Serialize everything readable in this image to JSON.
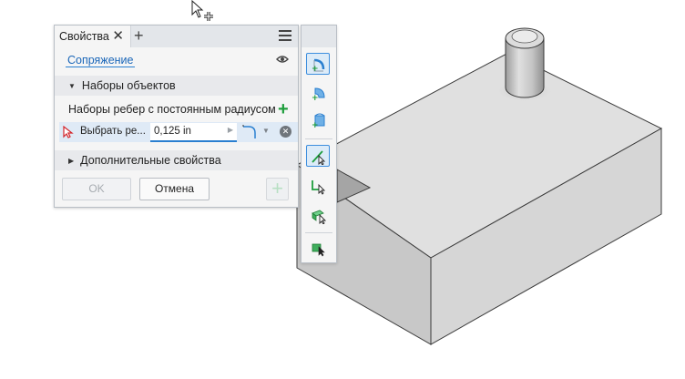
{
  "panel": {
    "tab_title": "Свойства",
    "tab_close": "✕",
    "add_tab": "+",
    "feature_name": "Сопряжение",
    "section_object_sets": "Наборы объектов",
    "edge_sets_label": "Наборы ребер с постоянным радиусом",
    "add_set": "+",
    "select_edges_label": "Выбрать ре...",
    "radius_value": "0,125 in",
    "section_additional": "Дополнительные свойства",
    "ok_label": "OK",
    "cancel_label": "Отмена",
    "apply_label": "+"
  },
  "icons": {
    "menu": "hamburger-icon",
    "visibility": "eye-icon",
    "select": "arrow-select-icon",
    "profile": "fillet-profile-icon",
    "clear": "clear-icon",
    "mini_toolbar": [
      "fillet-edge-icon",
      "fillet-face-icon",
      "fillet-full-round-icon",
      "select-edge-icon",
      "select-loop-icon",
      "select-feature-icon",
      "select-solid-icon"
    ]
  },
  "colors": {
    "accent_blue": "#2a7fd0",
    "add_green": "#1e9e3c",
    "selection_row": "#dfeaf6",
    "model_top": "#e0e0e0",
    "model_front": "#c8c8c8",
    "model_side": "#d6d6d6"
  }
}
